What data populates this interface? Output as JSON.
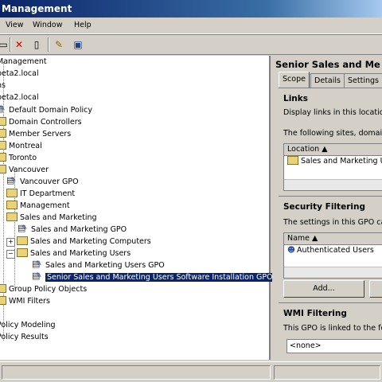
{
  "window": {
    "title": "Management"
  },
  "menu": {
    "items": [
      "View",
      "Window",
      "Help"
    ]
  },
  "toolbar": {
    "icons": [
      "folder-icon",
      "delete-icon",
      "properties-icon",
      "refresh-icon",
      "help-icon",
      "console-icon"
    ]
  },
  "tree": {
    "nodes": [
      "Management",
      "beta2.local",
      "ns",
      "beta2.local",
      "Default Domain Policy",
      "Domain Controllers",
      "Member Servers",
      "Montreal",
      "Toronto",
      "Vancouver",
      "Vancouver GPO",
      "IT Department",
      "Management",
      "Sales and Marketing",
      "Sales and Marketing GPO",
      "Sales and Marketing Computers",
      "Sales and Marketing Users",
      "Sales and Marketing Users GPO",
      "Senior Sales and Marketing Users Software Installation GPO",
      "Group Policy Objects",
      "WMI Filters",
      "Policy Modeling",
      "Policy Results"
    ]
  },
  "details": {
    "title": "Senior Sales and Me",
    "tabs": [
      "Scope",
      "Details",
      "Settings"
    ],
    "links": {
      "title": "Links",
      "text1": "Display links in this location:",
      "text2": "The following sites, domains",
      "column": "Location",
      "rows": [
        "Sales and Marketing Us"
      ]
    },
    "security": {
      "title": "Security Filtering",
      "text": "The settings in this GPO ca",
      "column": "Name",
      "rows": [
        "Authenticated Users"
      ],
      "add_label": "Add..."
    },
    "wmi": {
      "title": "WMI Filtering",
      "text": "This GPO is linked to the fo",
      "value": "<none>"
    }
  }
}
